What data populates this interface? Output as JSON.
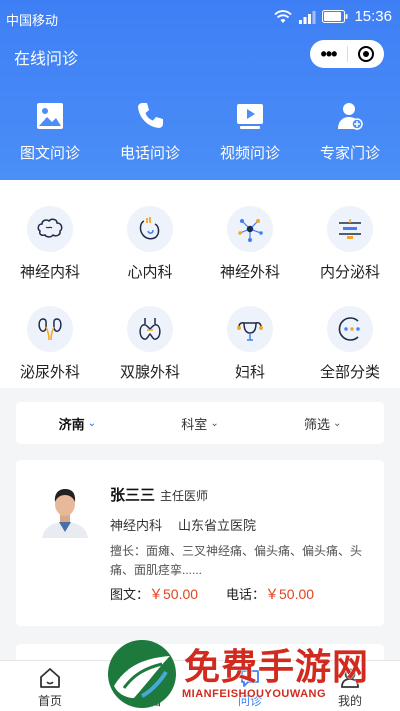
{
  "status_bar": {
    "carrier": "中国移动",
    "time": "15:36"
  },
  "app": {
    "title": "在线问诊",
    "capsule_more": "•••"
  },
  "consult_types": [
    {
      "label": "图文问诊",
      "icon": "image-icon"
    },
    {
      "label": "电话问诊",
      "icon": "phone-icon"
    },
    {
      "label": "视频问诊",
      "icon": "video-icon"
    },
    {
      "label": "专家门诊",
      "icon": "doctor-icon"
    }
  ],
  "departments": [
    {
      "label": "神经内科",
      "icon": "brain-icon"
    },
    {
      "label": "心内科",
      "icon": "heart-icon"
    },
    {
      "label": "神经外科",
      "icon": "neuron-icon"
    },
    {
      "label": "内分泌科",
      "icon": "scale-icon"
    },
    {
      "label": "泌尿外科",
      "icon": "kidney-icon"
    },
    {
      "label": "双腺外科",
      "icon": "thyroid-icon"
    },
    {
      "label": "妇科",
      "icon": "uterus-icon"
    },
    {
      "label": "全部分类",
      "icon": "all-icon"
    }
  ],
  "filters": [
    {
      "label": "济南",
      "active": true
    },
    {
      "label": "科室",
      "active": false
    },
    {
      "label": "筛选",
      "active": false
    }
  ],
  "doctor": {
    "name": "张三三",
    "title": "主任医师",
    "department": "神经内科",
    "hospital": "山东省立医院",
    "skill": "擅长：面瘫、三叉神经痛、偏头痛、偏头痛、头痛、面肌痉挛......",
    "text_price_label": "图文：",
    "text_price": "￥50.00",
    "phone_price_label": "电话：",
    "phone_price": "￥50.00"
  },
  "tabs": [
    {
      "label": "首页",
      "icon": "home-icon",
      "active": false
    },
    {
      "label": "报告",
      "icon": "report-icon",
      "active": false
    },
    {
      "label": "问诊",
      "icon": "consult-icon",
      "active": true
    },
    {
      "label": "我的",
      "icon": "user-icon",
      "active": false
    }
  ],
  "watermark": {
    "text": "免费手游网",
    "sub": "MIANFEISHOUYOUWANG"
  },
  "colors": {
    "primary": "#3f7ff5",
    "price": "#e0431f",
    "watermark": "#d12a1e"
  }
}
